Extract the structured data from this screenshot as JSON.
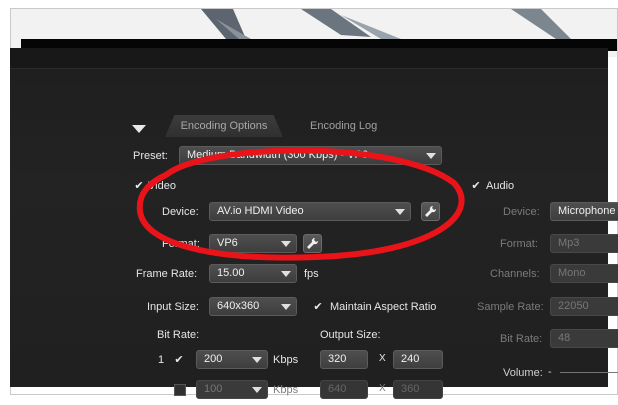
{
  "tabs": {
    "encoding_options": "Encoding Options",
    "encoding_log": "Encoding Log"
  },
  "preset": {
    "label": "Preset:",
    "value": "Medium Bandwidth (300 Kbps) - VP6"
  },
  "video": {
    "label": "Video",
    "checked_mark": "✔",
    "device_label": "Device:",
    "device_value": "AV.io HDMI Video",
    "format_label": "Format:",
    "format_value": "VP6",
    "frame_rate_label": "Frame Rate:",
    "frame_rate_value": "15.00",
    "frame_rate_unit": "fps",
    "input_size_label": "Input Size:",
    "input_size_value": "640x360",
    "maintain_aspect_label": "Maintain Aspect Ratio",
    "bit_rate_label": "Bit Rate:",
    "output_size_label": "Output Size:",
    "row1": {
      "index": "1",
      "bitrate": "200",
      "unit": "Kbps",
      "width": "320",
      "x": "X",
      "height": "240"
    },
    "row2": {
      "bitrate": "100",
      "unit": "Kbps",
      "width": "640",
      "x": "X",
      "height": "360"
    }
  },
  "audio": {
    "label": "Audio",
    "device_label": "Device:",
    "device_value": "Microphone",
    "format_label": "Format:",
    "format_value": "Mp3",
    "channels_label": "Channels:",
    "channels_value": "Mono",
    "sample_rate_label": "Sample Rate:",
    "sample_rate_value": "22050",
    "bit_rate_label": "Bit Rate:",
    "bit_rate_value": "48",
    "volume_label": "Volume:",
    "volume_min": "-"
  },
  "annotation": {
    "color": "#e8141a"
  }
}
